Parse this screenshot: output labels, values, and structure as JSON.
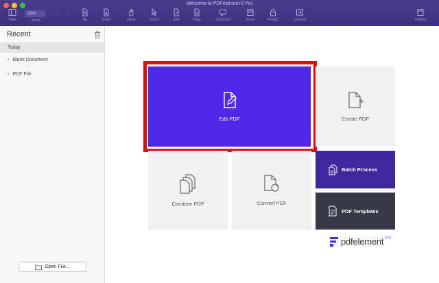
{
  "window": {
    "title": "Welcome to PDFelement 6 Pro"
  },
  "toolbar": {
    "zoom_value": "125%",
    "items": [
      {
        "label": "View",
        "icon": "sidebar-view-icon"
      },
      {
        "label": "Zoom",
        "icon": "zoom-icon"
      },
      {
        "label": "Up",
        "icon": "page-up-icon"
      },
      {
        "label": "Down",
        "icon": "page-down-icon"
      },
      {
        "label": "Hand",
        "icon": "hand-icon"
      },
      {
        "label": "Select",
        "icon": "select-cursor-icon"
      },
      {
        "label": "Edit",
        "icon": "edit-icon"
      },
      {
        "label": "Page",
        "icon": "page-icon"
      },
      {
        "label": "Comment",
        "icon": "comment-icon"
      },
      {
        "label": "Form",
        "icon": "form-icon"
      },
      {
        "label": "Protect",
        "icon": "lock-icon"
      },
      {
        "label": "Convert",
        "icon": "convert-icon"
      },
      {
        "label": "Format",
        "icon": "format-icon"
      }
    ]
  },
  "sidebar": {
    "title": "Recent",
    "section": "Today",
    "items": [
      "Blank Document",
      "PDF File"
    ],
    "open_button": "Open File..."
  },
  "tiles": {
    "edit": "Edit PDF",
    "create": "Create PDF",
    "combine": "Combine PDF",
    "convert": "Convert PDF",
    "batch": "Batch Process",
    "templates": "PDF Templates"
  },
  "brand": {
    "name": "pdfelement",
    "pro": "pro"
  },
  "colors": {
    "titlebar": "#3e3180",
    "edit_tile": "#4e27ea",
    "batch_tile": "#3f279d",
    "templates_tile": "#363a47",
    "highlight": "#e60c0c"
  }
}
